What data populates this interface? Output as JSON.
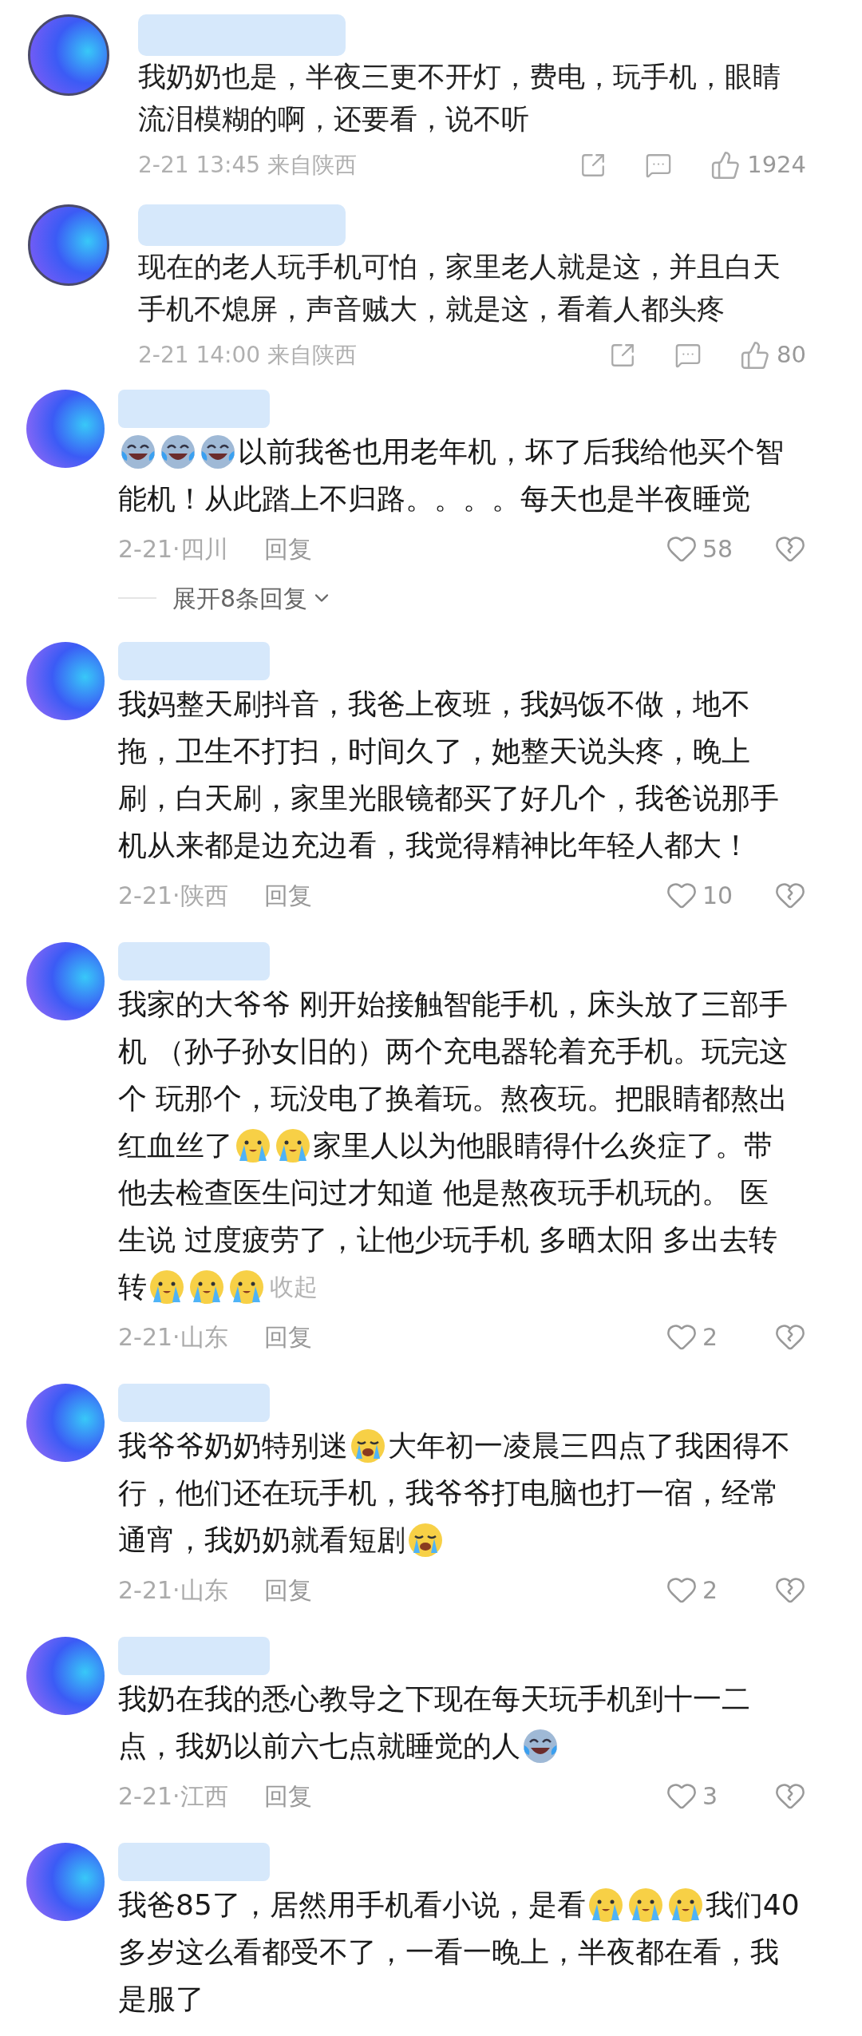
{
  "comments": [
    {
      "kind": "weibo",
      "lines": [
        [
          {
            "kind": "text",
            "text": "我奶奶也是，半夜三更不开灯，费电，玩手机，眼睛"
          }
        ],
        [
          {
            "kind": "text",
            "text": "流泪模糊的啊，还要看，说不听"
          }
        ]
      ],
      "time": "2-21 13:45 来自陕西",
      "likes": "1924"
    },
    {
      "kind": "weibo",
      "lines": [
        [
          {
            "kind": "text",
            "text": "现在的老人玩手机可怕，家里老人就是这，并且白天"
          }
        ],
        [
          {
            "kind": "text",
            "text": "手机不熄屏，声音贼大，就是这，看着人都头疼"
          }
        ]
      ],
      "time": "2-21 14:00 来自陕西",
      "likes": "80"
    },
    {
      "kind": "douyin",
      "lines": [
        [
          {
            "kind": "laugh"
          },
          {
            "kind": "laugh"
          },
          {
            "kind": "laugh"
          },
          {
            "kind": "text",
            "text": "以前我爸也用老年机，坏了后我给他买个智"
          }
        ],
        [
          {
            "kind": "text",
            "text": "能机！从此踏上不归路。。。。每天也是半夜睡觉"
          }
        ]
      ],
      "time": "2-21·四川",
      "reply": "回复",
      "likes": "58",
      "expand": "展开8条回复"
    },
    {
      "kind": "douyin",
      "lines": [
        [
          {
            "kind": "text",
            "text": "我妈整天刷抖音，我爸上夜班，我妈饭不做，地不"
          }
        ],
        [
          {
            "kind": "text",
            "text": "拖，卫生不打扫，时间久了，她整天说头疼，晚上"
          }
        ],
        [
          {
            "kind": "text",
            "text": "刷，白天刷，家里光眼镜都买了好几个，我爸说那手"
          }
        ],
        [
          {
            "kind": "text",
            "text": "机从来都是边充边看，我觉得精神比年轻人都大！"
          }
        ]
      ],
      "time": "2-21·陕西",
      "reply": "回复",
      "likes": "10"
    },
    {
      "kind": "douyin",
      "lines": [
        [
          {
            "kind": "text",
            "text": "我家的大爷爷 刚开始接触智能手机，床头放了三部手"
          }
        ],
        [
          {
            "kind": "text",
            "text": "机 （孙子孙女旧的）两个充电器轮着充手机。玩完这"
          }
        ],
        [
          {
            "kind": "text",
            "text": "个 玩那个，玩没电了换着玩。熬夜玩。把眼睛都熬出"
          }
        ],
        [
          {
            "kind": "text",
            "text": "红血丝了"
          },
          {
            "kind": "tearful"
          },
          {
            "kind": "tearful"
          },
          {
            "kind": "text",
            "text": "家里人以为他眼睛得什么炎症了。带"
          }
        ],
        [
          {
            "kind": "text",
            "text": "他去检查医生问过才知道 他是熬夜玩手机玩的。 医"
          }
        ],
        [
          {
            "kind": "text",
            "text": "生说 过度疲劳了，让他少玩手机 多晒太阳 多出去转"
          }
        ],
        [
          {
            "kind": "text",
            "text": "转"
          },
          {
            "kind": "tearful"
          },
          {
            "kind": "tearful"
          },
          {
            "kind": "tearful"
          },
          {
            "kind": "link",
            "text": "收起"
          }
        ]
      ],
      "time": "2-21·山东",
      "reply": "回复",
      "likes": "2"
    },
    {
      "kind": "douyin",
      "lines": [
        [
          {
            "kind": "text",
            "text": "我爷爷奶奶特别迷"
          },
          {
            "kind": "sob"
          },
          {
            "kind": "text",
            "text": "大年初一凌晨三四点了我困得不"
          }
        ],
        [
          {
            "kind": "text",
            "text": "行，他们还在玩手机，我爷爷打电脑也打一宿，经常"
          }
        ],
        [
          {
            "kind": "text",
            "text": "通宵，我奶奶就看短剧"
          },
          {
            "kind": "sob"
          }
        ]
      ],
      "time": "2-21·山东",
      "reply": "回复",
      "likes": "2"
    },
    {
      "kind": "douyin",
      "lines": [
        [
          {
            "kind": "text",
            "text": "我奶在我的悉心教导之下现在每天玩手机到十一二"
          }
        ],
        [
          {
            "kind": "text",
            "text": "点，我奶以前六七点就睡觉的人"
          },
          {
            "kind": "laugh"
          }
        ]
      ],
      "time": "2-21·江西",
      "reply": "回复",
      "likes": "3"
    },
    {
      "kind": "douyin",
      "lines": [
        [
          {
            "kind": "text",
            "text": "我爸85了，居然用手机看小说，是看"
          },
          {
            "kind": "tearful"
          },
          {
            "kind": "tearful"
          },
          {
            "kind": "tearful"
          },
          {
            "kind": "text",
            "text": "我们40"
          }
        ],
        [
          {
            "kind": "text",
            "text": "多岁这么看都受不了，一看一晚上，半夜都在看，我"
          }
        ],
        [
          {
            "kind": "text",
            "text": "是服了"
          }
        ]
      ]
    }
  ]
}
